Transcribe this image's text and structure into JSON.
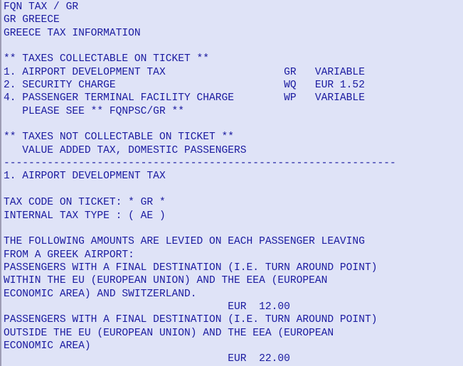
{
  "screen": {
    "title": "FQN TAX / GR",
    "background_color": "#dfe3f7",
    "text_color": "#1a1aa0",
    "border_color": "#9d9db4",
    "header": {
      "command_line": "FQN TAX / GR",
      "country_line": "GR GREECE",
      "subtitle_line": "GREECE TAX INFORMATION"
    },
    "collectable_section": {
      "heading": "** TAXES COLLECTABLE ON TICKET **",
      "items": [
        {
          "number": "1.",
          "name": "AIRPORT DEVELOPMENT TAX",
          "code": "GR",
          "amount": "VARIABLE"
        },
        {
          "number": "2.",
          "name": "SECURITY CHARGE",
          "code": "WQ",
          "amount": "EUR 1.52"
        },
        {
          "number": "4.",
          "name": "PASSENGER TERMINAL FACILITY CHARGE",
          "code": "WP",
          "amount": "VARIABLE"
        }
      ],
      "note": "PLEASE SEE ** FQNPSC/GR **"
    },
    "not_collectable_section": {
      "heading": "** TAXES NOT COLLECTABLE ON TICKET **",
      "items": [
        "VALUE ADDED TAX, DOMESTIC PASSENGERS"
      ]
    },
    "separator": "---------------------------------------------------------------",
    "detail_section": {
      "title": "1. AIRPORT DEVELOPMENT TAX",
      "tax_code_label": "TAX CODE ON TICKET: * GR *",
      "internal_type_label": "INTERNAL TAX TYPE : ( AE )",
      "body_lines": [
        "THE FOLLOWING AMOUNTS ARE LEVIED ON EACH PASSENGER LEAVING",
        "FROM A GREEK AIRPORT:",
        "PASSENGERS WITH A FINAL DESTINATION (I.E. TURN AROUND POINT)",
        "WITHIN THE EU (EUROPEAN UNION) AND THE EEA (EUROPEAN",
        "ECONOMIC AREA) AND SWITZERLAND."
      ],
      "amount_one": "EUR  12.00",
      "body_lines_two": [
        "PASSENGERS WITH A FINAL DESTINATION (I.E. TURN AROUND POINT)",
        "OUTSIDE THE EU (EUROPEAN UNION) AND THE EEA (EUROPEAN",
        "ECONOMIC AREA)"
      ],
      "amount_two": "EUR  22.00"
    },
    "rendered_lines": [
      "FQN TAX / GR",
      "GR GREECE",
      "GREECE TAX INFORMATION",
      "",
      "** TAXES COLLECTABLE ON TICKET **",
      "1. AIRPORT DEVELOPMENT TAX                   GR   VARIABLE",
      "2. SECURITY CHARGE                           WQ   EUR 1.52",
      "4. PASSENGER TERMINAL FACILITY CHARGE        WP   VARIABLE",
      "   PLEASE SEE ** FQNPSC/GR **",
      "",
      "** TAXES NOT COLLECTABLE ON TICKET **",
      "   VALUE ADDED TAX, DOMESTIC PASSENGERS",
      "---------------------------------------------------------------",
      "1. AIRPORT DEVELOPMENT TAX",
      "",
      "TAX CODE ON TICKET: * GR *",
      "INTERNAL TAX TYPE : ( AE )",
      "",
      "THE FOLLOWING AMOUNTS ARE LEVIED ON EACH PASSENGER LEAVING",
      "FROM A GREEK AIRPORT:",
      "PASSENGERS WITH A FINAL DESTINATION (I.E. TURN AROUND POINT)",
      "WITHIN THE EU (EUROPEAN UNION) AND THE EEA (EUROPEAN",
      "ECONOMIC AREA) AND SWITZERLAND.",
      "                                    EUR  12.00",
      "PASSENGERS WITH A FINAL DESTINATION (I.E. TURN AROUND POINT)",
      "OUTSIDE THE EU (EUROPEAN UNION) AND THE EEA (EUROPEAN",
      "ECONOMIC AREA)",
      "                                    EUR  22.00"
    ]
  }
}
